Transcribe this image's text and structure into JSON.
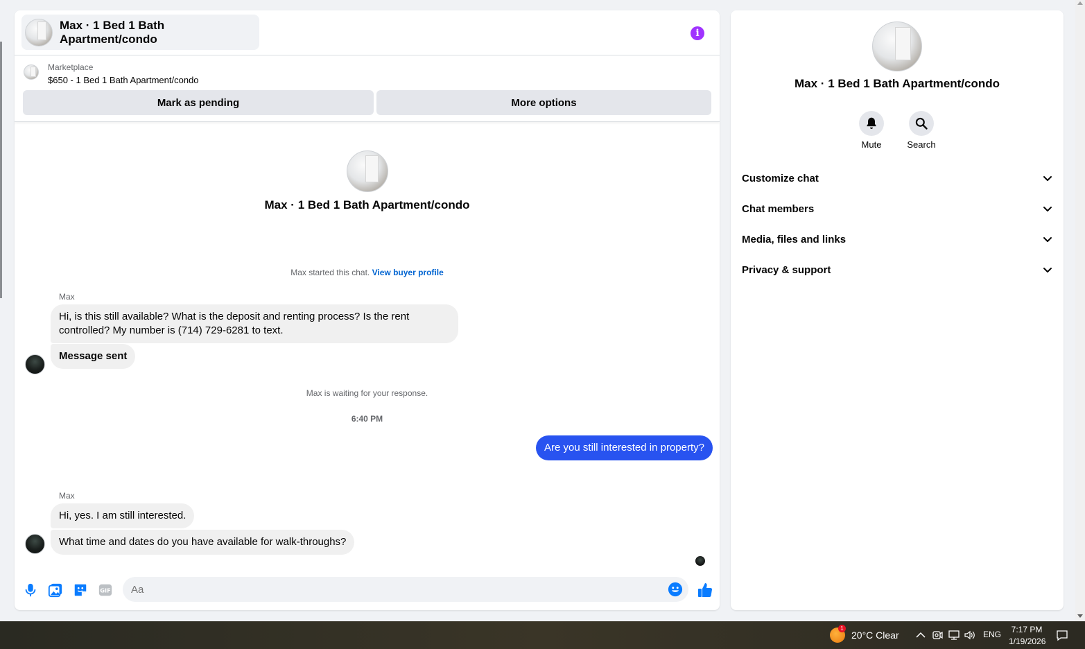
{
  "header": {
    "title": "Max · 1 Bed 1 Bath Apartment/condo"
  },
  "listing": {
    "source_label": "Marketplace",
    "price_line": "$650 - 1 Bed 1 Bath Apartment/condo",
    "mark_pending_label": "Mark as pending",
    "more_options_label": "More options"
  },
  "thread": {
    "title": "Max · 1 Bed 1 Bath Apartment/condo",
    "started_text": "Max started this chat.",
    "view_profile_link": "View buyer profile",
    "sender1": "Max",
    "msg1": "Hi, is this still available? What is the deposit and renting process? Is the rent controlled? My number is (714) 729-6281 to text.",
    "msg2": "Message sent",
    "waiting_text": "Max is waiting for your response.",
    "time_stamp": "6:40 PM",
    "msg_out": "Are you still interested in property?",
    "sender2": "Max",
    "msg3": "Hi, yes. I am still interested.",
    "msg4": "What time and dates do you have available for walk-throughs?"
  },
  "composer": {
    "placeholder": "Aa"
  },
  "info_panel": {
    "title": "Max · 1 Bed 1 Bath Apartment/condo",
    "mute_label": "Mute",
    "search_label": "Search",
    "sections": [
      "Customize chat",
      "Chat members",
      "Media, files and links",
      "Privacy & support"
    ]
  },
  "taskbar": {
    "weather_badge": "1",
    "weather": "20°C  Clear",
    "language": "ENG",
    "time": "7:17 PM",
    "date": "1/19/2026"
  },
  "colors": {
    "accent": "#0a7cff",
    "outgoing_bubble": "#2853f0",
    "info_icon": "#a033ff"
  }
}
